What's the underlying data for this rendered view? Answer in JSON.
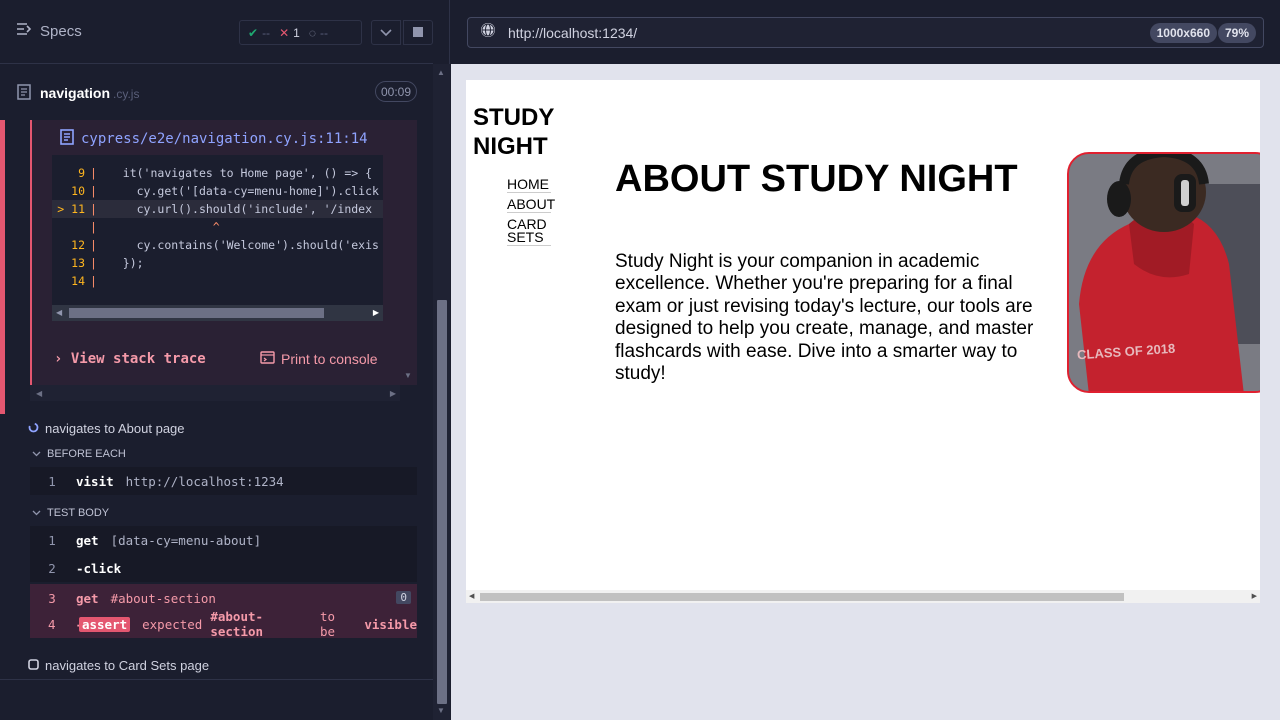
{
  "runner": {
    "specs_label": "Specs",
    "stats": {
      "passed": "--",
      "failed": "1",
      "pending": "--"
    },
    "spec_file": {
      "name": "navigation",
      "ext": ".cy.js",
      "duration": "00:09"
    },
    "error": {
      "file_link": "cypress/e2e/navigation.cy.js:11:14",
      "code_lines": [
        {
          "num": "9",
          "text": "  it('navigates to Home page', () => {"
        },
        {
          "num": "10",
          "text": "    cy.get('[data-cy=menu-home]').click"
        },
        {
          "num": "11",
          "marker": ">",
          "text": "    cy.url().should('include', '/index"
        },
        {
          "num": "",
          "text": "               ^"
        },
        {
          "num": "12",
          "text": "    cy.contains('Welcome').should('exis"
        },
        {
          "num": "13",
          "text": "  });"
        },
        {
          "num": "14",
          "text": ""
        }
      ],
      "view_stack_trace": "View stack trace",
      "print_to_console": "Print to console"
    },
    "tests": [
      {
        "title": "navigates to About page"
      },
      {
        "title": "navigates to Card Sets page"
      }
    ],
    "hooks": {
      "before_each": "BEFORE EACH",
      "test_body": "TEST BODY"
    },
    "before_each_cmds": [
      {
        "num": "1",
        "name": "visit",
        "msg": "http://localhost:1234"
      }
    ],
    "body_cmds": [
      {
        "num": "1",
        "name": "get",
        "msg": "[data-cy=menu-about]"
      },
      {
        "num": "2",
        "name": "-click",
        "msg": ""
      },
      {
        "num": "3",
        "name": "get",
        "msg": "#about-section",
        "badge": "0"
      },
      {
        "num": "4",
        "name": "-",
        "tag": "assert",
        "msg_parts": [
          "expected",
          "#about-section",
          "to be",
          "visible"
        ]
      }
    ]
  },
  "browser": {
    "url": "http://localhost:1234/",
    "viewport": "1000x660",
    "zoom": "79%"
  },
  "site": {
    "logo_line1": "STUDY",
    "logo_line2": "NIGHT",
    "nav": [
      "HOME",
      "ABOUT",
      "CARD SETS"
    ],
    "heading": "ABOUT STUDY NIGHT",
    "paragraph": "Study Night is your companion in academic excellence. Whether you're preparing for a final exam or just revising today's lecture, our tools are designed to help you create, manage, and master flashcards with ease. Dive into a smarter way to study!",
    "image_text": "CLASS OF 2018"
  },
  "colors": {
    "fail": "#e45770",
    "pass": "#1fa971",
    "link": "#8fa3ff",
    "image_border": "#e0202f"
  }
}
